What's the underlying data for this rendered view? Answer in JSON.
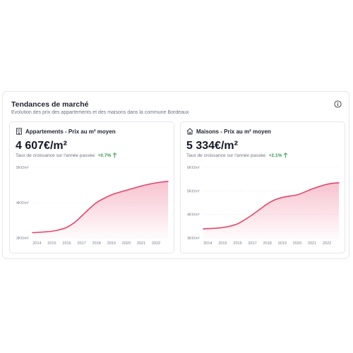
{
  "header": {
    "title": "Tendances de marché",
    "subtitle": "Evolution des prix des appartements et des maisons dans la commune Bordeaux"
  },
  "panels": [
    {
      "icon": "building-icon",
      "title": "Appartements - Prix au m² moyen",
      "price": "4 607€/m²",
      "growth_label": "Taux de croissance sur l'année passée:",
      "growth_value": "+0.7%"
    },
    {
      "icon": "house-icon",
      "title": "Maisons - Prix au m² moyen",
      "price": "5 334€/m²",
      "growth_label": "Taux de croissance sur l'année passée:",
      "growth_value": "+2.1%"
    }
  ],
  "colors": {
    "line": "#e8436a",
    "growth": "#2e9a4b"
  },
  "chart_data": [
    {
      "type": "area",
      "title": "Appartements - Prix au m² moyen",
      "x": [
        2013.7,
        2014,
        2014.5,
        2015,
        2015.5,
        2016,
        2016.5,
        2017,
        2017.5,
        2018,
        2018.5,
        2019,
        2019.5,
        2020,
        2020.5,
        2021,
        2021.5,
        2022,
        2022.5,
        2022.8
      ],
      "series": [
        {
          "values": [
            3150,
            3155,
            3170,
            3190,
            3230,
            3300,
            3430,
            3620,
            3820,
            4000,
            4120,
            4220,
            4290,
            4350,
            4410,
            4470,
            4520,
            4560,
            4590,
            4600
          ]
        }
      ],
      "x_ticks": [
        "2014",
        "2015",
        "2016",
        "2017",
        "2018",
        "2019",
        "2020",
        "2021",
        "2022"
      ],
      "y_ticks": [
        "3K€/m²",
        "4K€/m²",
        "5K€/m²"
      ],
      "ylim": [
        3000,
        5000
      ],
      "xlim": [
        2013.7,
        2022.8
      ],
      "grid": "horizontal-dashed"
    },
    {
      "type": "area",
      "title": "Maisons - Prix au m² moyen",
      "x": [
        2013.7,
        2014,
        2014.5,
        2015,
        2015.5,
        2016,
        2016.5,
        2017,
        2017.5,
        2018,
        2018.5,
        2019,
        2019.5,
        2020,
        2020.5,
        2021,
        2021.5,
        2022,
        2022.5,
        2022.8
      ],
      "series": [
        {
          "values": [
            3380,
            3400,
            3410,
            3440,
            3500,
            3600,
            3780,
            3990,
            4220,
            4450,
            4620,
            4720,
            4780,
            4830,
            4950,
            5080,
            5190,
            5280,
            5330,
            5340
          ]
        }
      ],
      "x_ticks": [
        "2014",
        "2015",
        "2016",
        "2017",
        "2018",
        "2019",
        "2020",
        "2021",
        "2022"
      ],
      "y_ticks": [
        "3K€/m²",
        "4K€/m²",
        "5K€/m²",
        "6K€/m²"
      ],
      "ylim": [
        3000,
        6000
      ],
      "xlim": [
        2013.7,
        2022.8
      ],
      "grid": "horizontal-dashed"
    }
  ]
}
